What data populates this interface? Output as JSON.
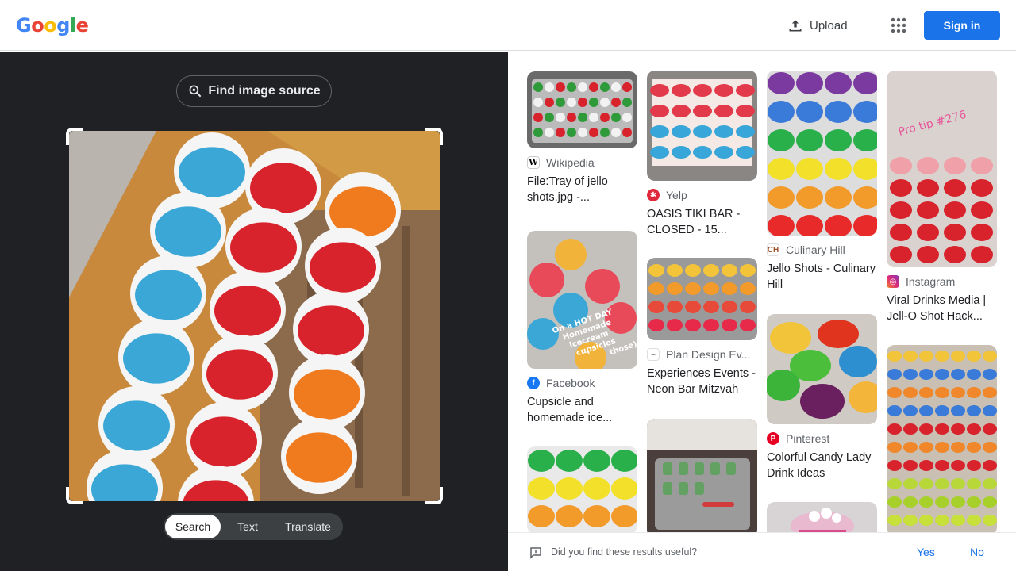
{
  "header": {
    "logo_letters": [
      {
        "ch": "G",
        "color": "#4285f4"
      },
      {
        "ch": "o",
        "color": "#ea4335"
      },
      {
        "ch": "o",
        "color": "#fbbc05"
      },
      {
        "ch": "g",
        "color": "#4285f4"
      },
      {
        "ch": "l",
        "color": "#34a853"
      },
      {
        "ch": "e",
        "color": "#ea4335"
      }
    ],
    "upload_label": "Upload",
    "signin_label": "Sign in"
  },
  "left": {
    "find_source_label": "Find image source",
    "tabs": [
      "Search",
      "Text",
      "Translate"
    ],
    "active_tab": "Search"
  },
  "results": [
    {
      "source": "Wikipedia",
      "favicon": "wikipedia-icon",
      "title": "File:Tray of jello shots.jpg -..."
    },
    {
      "source": "Yelp",
      "favicon": "yelp-icon",
      "title": "OASIS TIKI BAR - CLOSED - 15..."
    },
    {
      "source": "Culinary Hill",
      "favicon": "culinary-hill-icon",
      "title": "Jello Shots - Culinary Hill"
    },
    {
      "source": "Instagram",
      "favicon": "instagram-icon",
      "title": "Viral Drinks Media | Jell-O Shot Hack..."
    },
    {
      "source": "Facebook",
      "favicon": "facebook-icon",
      "title": "Cupsicle and homemade ice..."
    },
    {
      "source": "Plan Design Ev...",
      "favicon": "plan-design-icon",
      "title": "Experiences Events - Neon Bar Mitzvah"
    },
    {
      "source": "Pinterest",
      "favicon": "pinterest-icon",
      "title": "Colorful Candy Lady Drink Ideas"
    }
  ],
  "overlay_text": {
    "pro_tip": "Pro tip #276",
    "facebook_caption": [
      "On a HOT DAY",
      "Homemade",
      "icecream",
      "cupsicles",
      "those)"
    ]
  },
  "feedback": {
    "question": "Did you find these results useful?",
    "yes": "Yes",
    "no": "No"
  }
}
